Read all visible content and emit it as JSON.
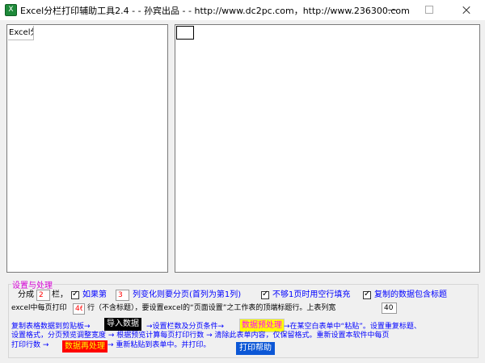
{
  "window": {
    "title": "Excel分栏打印辅助工具2.4 -  - 孙宾出品 -  - http://www.dc2pc.com，http://www.236300.com",
    "icon_name": "excel-app-icon",
    "icon_glyph": "X"
  },
  "left_pane": {
    "cell_text": "Excel分"
  },
  "settings": {
    "group_title": "设置与处理",
    "columns_prefix": "分成",
    "columns_value": "2",
    "columns_suffix": "栏，",
    "page_break_label": "如果第",
    "page_break_value": "3",
    "page_break_suffix": "列变化则要分页(首列为第1列)",
    "fill_blank_label": "不够1页时用空行填充",
    "copy_label_label": "复制的数据包含标题",
    "rows_prefix": "excel中每页打印",
    "rows_value": "46",
    "rows_suffix": "行（不含标题），要设置excel的“页面设置”之工作表的顶端标题行。上表列宽",
    "col_width_value": "40",
    "checkboxes": {
      "page_break": true,
      "fill_blank": true,
      "copy_label": true
    }
  },
  "instructions": {
    "step1": "复制表格数据到剪贴板→",
    "import_button": "导入数据",
    "step2": "→设置栏数及分页条件→",
    "preprocess_button": "数据预处理",
    "step3": "→在某空白表单中“粘贴”。设置重复标题、",
    "step4": "设置格式，分页预览调整宽度 → 根据预览计算每页打印行数 → 清除此表单内容，仅保留格式。重新设置本软件中每页",
    "step5": "打印行数  →",
    "reprocess_button": "数据再处理",
    "step6": "→ 重新粘贴到表单中。并打印。",
    "help_button": "打印帮助"
  },
  "colors": {
    "accent_blue": "#0000ff",
    "group_title": "#d400d4",
    "field_value": "#ff0000"
  }
}
